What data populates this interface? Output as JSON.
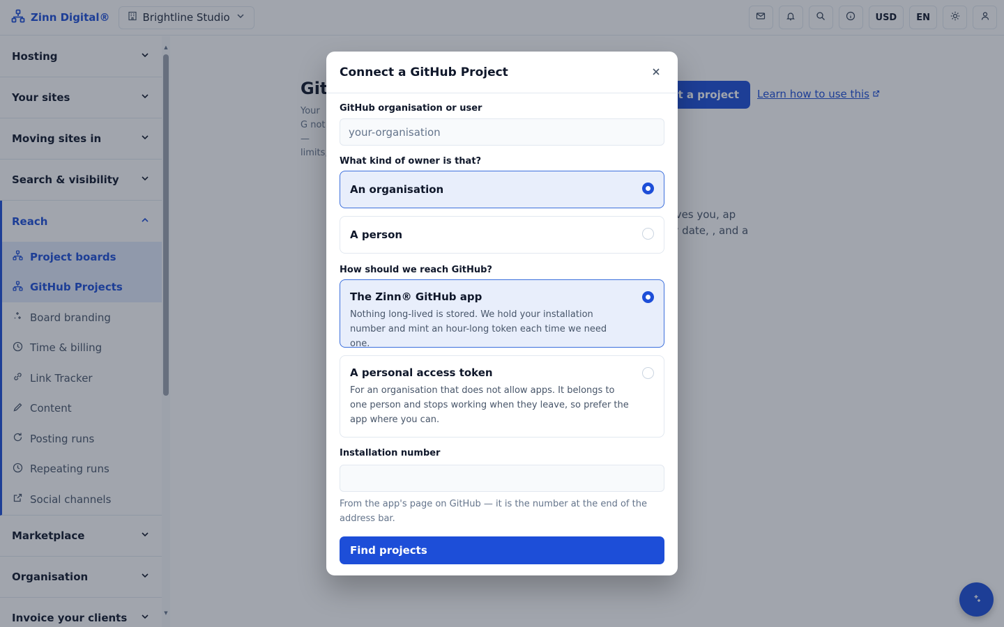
{
  "topbar": {
    "brand": "Zinn Digital®",
    "workspace": "Brightline Studio",
    "currency": "USD",
    "language": "EN"
  },
  "sidebar": {
    "sections": [
      {
        "label": "Hosting"
      },
      {
        "label": "Your sites"
      },
      {
        "label": "Moving sites in"
      },
      {
        "label": "Search & visibility"
      }
    ],
    "reach": {
      "label": "Reach",
      "items": [
        {
          "label": "Project boards",
          "icon": "hierarchy-icon"
        },
        {
          "label": "GitHub Projects",
          "icon": "hierarchy-icon"
        },
        {
          "label": "Board branding",
          "icon": "sparkle-icon"
        },
        {
          "label": "Time & billing",
          "icon": "clock-icon"
        },
        {
          "label": "Link Tracker",
          "icon": "link-icon"
        },
        {
          "label": "Content",
          "icon": "pencil-icon"
        },
        {
          "label": "Posting runs",
          "icon": "refresh-icon"
        },
        {
          "label": "Repeating runs",
          "icon": "clock-icon"
        },
        {
          "label": "Social channels",
          "icon": "external-link-icon"
        }
      ]
    },
    "after": [
      {
        "label": "Marketplace"
      },
      {
        "label": "Organisation"
      },
      {
        "label": "Invoice your clients"
      }
    ]
  },
  "background": {
    "title": "Git",
    "desc": "Your G not — limits,",
    "connect_button": "ct a project",
    "learn_link": "Learn how to use this",
    "card_title": "d",
    "card_text": "gives you, ap by date, , and a"
  },
  "modal": {
    "title": "Connect a GitHub Project",
    "org_label": "GitHub organisation or user",
    "org_placeholder": "your-organisation",
    "owner_label": "What kind of owner is that?",
    "owner_options": [
      {
        "title": "An organisation",
        "selected": true
      },
      {
        "title": "A person",
        "selected": false
      }
    ],
    "reach_label": "How should we reach GitHub?",
    "reach_options": [
      {
        "title": "The Zinn® GitHub app",
        "desc": "Nothing long-lived is stored. We hold your installation number and mint an hour-long token each time we need one.",
        "selected": true
      },
      {
        "title": "A personal access token",
        "desc": "For an organisation that does not allow apps. It belongs to one person and stops working when they leave, so prefer the app where you can.",
        "selected": false
      }
    ],
    "install_label": "Installation number",
    "install_value": "",
    "install_help": "From the app's page on GitHub — it is the number at the end of the address bar.",
    "submit": "Find projects"
  },
  "colors": {
    "accent": "#1d4ed8",
    "selected_bg": "#e8eefb"
  }
}
